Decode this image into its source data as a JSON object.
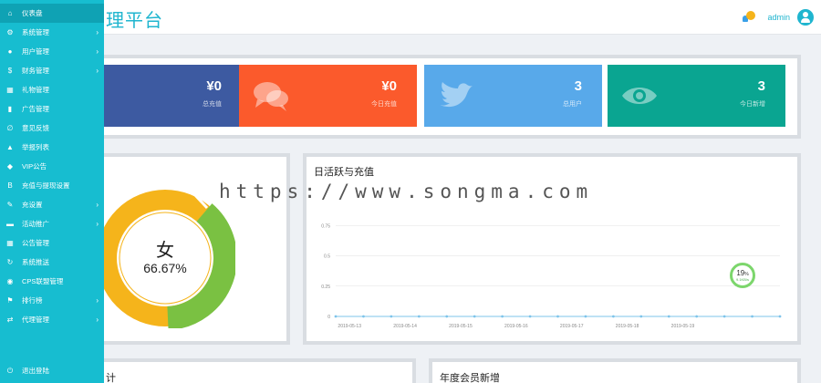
{
  "header": {
    "title": "理平台",
    "admin_name": "admin"
  },
  "sidebar": {
    "items": [
      {
        "label": "仪表盘",
        "icon": "home-icon",
        "glyph": "⌂",
        "has_children": false,
        "active": true
      },
      {
        "label": "系统管理",
        "icon": "cogs-icon",
        "glyph": "⚙",
        "has_children": true
      },
      {
        "label": "用户管理",
        "icon": "user-icon",
        "glyph": "●",
        "has_children": true
      },
      {
        "label": "财务管理",
        "icon": "dollar-icon",
        "glyph": "$",
        "has_children": true
      },
      {
        "label": "礼物管理",
        "icon": "grid-icon",
        "glyph": "▦",
        "has_children": false
      },
      {
        "label": "广告管理",
        "icon": "tablet-icon",
        "glyph": "▮",
        "has_children": false
      },
      {
        "label": "意见反馈",
        "icon": "paperclip-icon",
        "glyph": "∅",
        "has_children": false
      },
      {
        "label": "举报列表",
        "icon": "warning-icon",
        "glyph": "▲",
        "has_children": false
      },
      {
        "label": "VIP公告",
        "icon": "car-icon",
        "glyph": "◆",
        "has_children": false
      },
      {
        "label": "充值与提现设置",
        "icon": "bold-icon",
        "glyph": "B",
        "has_children": false
      },
      {
        "label": "充设置",
        "icon": "wrench-icon",
        "glyph": "✎",
        "has_children": true
      },
      {
        "label": "活动推广",
        "icon": "briefcase-icon",
        "glyph": "▬",
        "has_children": true
      },
      {
        "label": "公告管理",
        "icon": "th-icon",
        "glyph": "▦",
        "has_children": false
      },
      {
        "label": "系统推送",
        "icon": "refresh-icon",
        "glyph": "↻",
        "has_children": false
      },
      {
        "label": "CPS联盟管理",
        "icon": "globe-icon",
        "glyph": "◉",
        "has_children": false
      },
      {
        "label": "排行榜",
        "icon": "flag-icon",
        "glyph": "⚑",
        "has_children": true
      },
      {
        "label": "代理管理",
        "icon": "retweet-icon",
        "glyph": "⇄",
        "has_children": true
      },
      {
        "label": "退出登陆",
        "icon": "power-icon",
        "glyph": "⏻",
        "has_children": false
      }
    ]
  },
  "cards": [
    {
      "value": "¥0",
      "label": "总充值",
      "icon": "money-icon",
      "color": "#3d5aa1"
    },
    {
      "value": "¥0",
      "label": "今日充值",
      "icon": "comments-icon",
      "color": "#fb5a2c"
    },
    {
      "value": "3",
      "label": "总用户",
      "icon": "twitter-icon",
      "color": "#58a9ea"
    },
    {
      "value": "3",
      "label": "今日新增",
      "icon": "eye-icon",
      "color": "#0aa591"
    }
  ],
  "donut": {
    "center_label": "女",
    "center_value": "66.67%",
    "colors": {
      "primary": "#f5b41b",
      "secondary": "#7ac142"
    }
  },
  "chart_data": {
    "type": "line",
    "title": "日活跃与充值",
    "x": [
      "2019-05-13",
      "2019-05-14",
      "2019-05-15",
      "2019-05-16",
      "2019-05-17",
      "2019-05-18",
      "2019-05-19"
    ],
    "y_ticks": [
      "0",
      "0.25",
      "0.5",
      "0.75"
    ],
    "ylim": [
      0,
      1
    ],
    "series": [
      {
        "values": [
          0,
          0,
          0,
          0,
          0,
          0,
          0,
          0,
          0,
          0,
          0,
          0,
          0,
          0,
          0,
          0,
          0
        ],
        "color": "#7ec4ea"
      }
    ],
    "grid": true
  },
  "badge": {
    "percent": "19",
    "unit": "%",
    "sub": "9.1KB/s",
    "color": "#7cd66c"
  },
  "bottom_panels": {
    "left_title": "计",
    "right_title": "年度会员新增"
  },
  "watermark": "https://www.songma.com"
}
